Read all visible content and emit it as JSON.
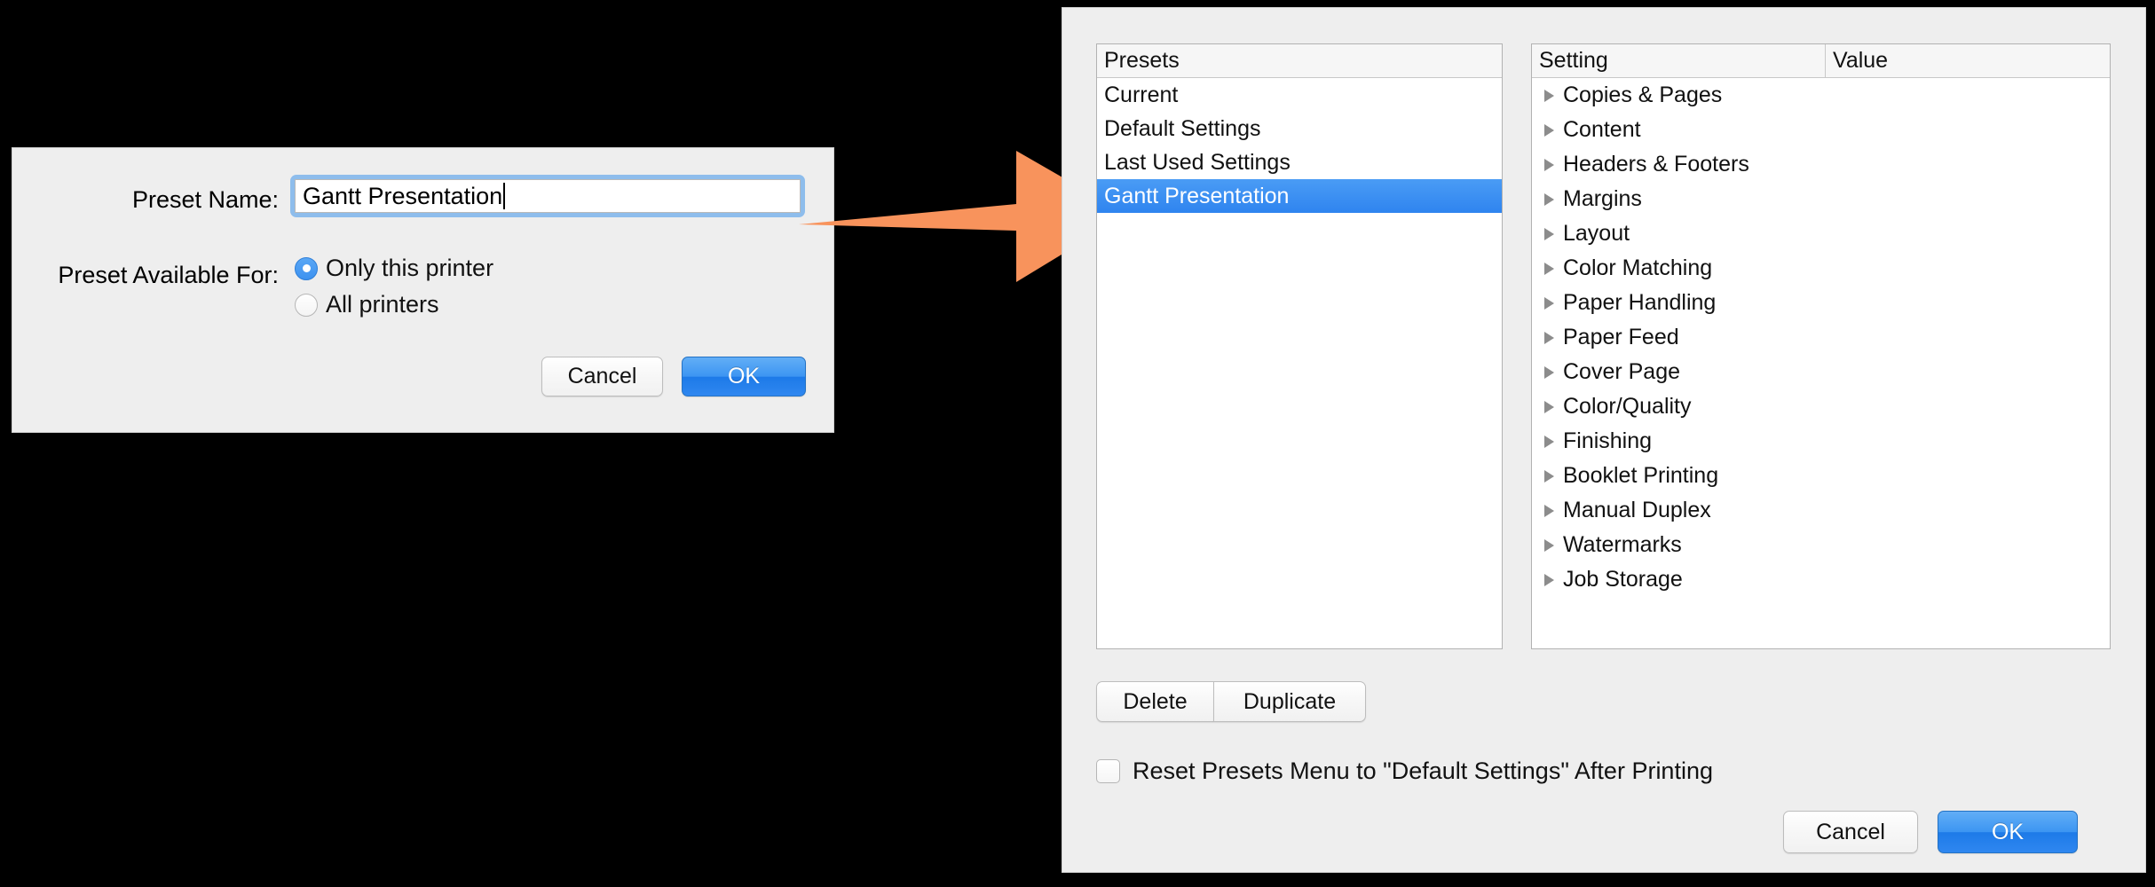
{
  "save_preset_sheet": {
    "preset_name_label": "Preset Name:",
    "preset_name_value": "Gantt Presentation",
    "preset_available_label": "Preset Available For:",
    "radio_options": [
      {
        "label": "Only this printer",
        "selected": true
      },
      {
        "label": "All printers",
        "selected": false
      }
    ],
    "cancel_label": "Cancel",
    "ok_label": "OK"
  },
  "annotation": {
    "arrow_color": "#f8935c",
    "points_from": "preset-name-field",
    "points_to": "preset-list-selected-row"
  },
  "presets_panel": {
    "presets_column": {
      "header": "Presets",
      "rows": [
        {
          "label": "Current",
          "selected": false
        },
        {
          "label": "Default Settings",
          "selected": false
        },
        {
          "label": "Last Used Settings",
          "selected": false
        },
        {
          "label": "Gantt Presentation",
          "selected": true
        }
      ]
    },
    "settings_column": {
      "headers": [
        "Setting",
        "Value"
      ],
      "rows": [
        {
          "label": "Copies & Pages",
          "value": ""
        },
        {
          "label": "Content",
          "value": ""
        },
        {
          "label": "Headers & Footers",
          "value": ""
        },
        {
          "label": "Margins",
          "value": ""
        },
        {
          "label": "Layout",
          "value": ""
        },
        {
          "label": "Color Matching",
          "value": ""
        },
        {
          "label": "Paper Handling",
          "value": ""
        },
        {
          "label": "Paper Feed",
          "value": ""
        },
        {
          "label": "Cover Page",
          "value": ""
        },
        {
          "label": "Color/Quality",
          "value": ""
        },
        {
          "label": "Finishing",
          "value": ""
        },
        {
          "label": "Booklet Printing",
          "value": ""
        },
        {
          "label": "Manual Duplex",
          "value": ""
        },
        {
          "label": "Watermarks",
          "value": ""
        },
        {
          "label": "Job Storage",
          "value": ""
        }
      ]
    },
    "delete_label": "Delete",
    "duplicate_label": "Duplicate",
    "reset_checkbox": {
      "label": "Reset Presets Menu to \"Default Settings\" After Printing",
      "checked": false
    },
    "cancel_label": "Cancel",
    "ok_label": "OK"
  },
  "colors": {
    "selection_blue": "#2f84ef",
    "accent_orange": "#f8935c",
    "panel_gray": "#eeeeee",
    "focus_ring_blue": "#8ebdec"
  }
}
